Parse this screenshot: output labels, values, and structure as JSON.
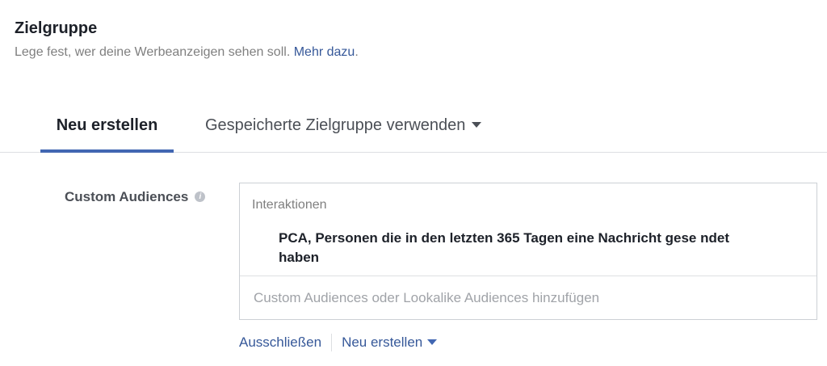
{
  "header": {
    "title": "Zielgruppe",
    "subtitle": "Lege fest, wer deine Werbeanzeigen sehen soll.",
    "subtitle_link": "Mehr dazu",
    "subtitle_end": "."
  },
  "tabs": [
    {
      "label": "Neu erstellen",
      "active": true
    },
    {
      "label": "Gespeicherte Zielgruppe verwenden",
      "icon": "caret-down-icon"
    }
  ],
  "custom_audiences": {
    "label": "Custom Audiences",
    "info_icon": "info-icon",
    "info_glyph": "i",
    "group_header": "Interaktionen",
    "selected_items": [
      "PCA, Personen die in den letzten 365 Tagen eine Nachricht gese ndet haben"
    ],
    "input_placeholder": "Custom Audiences oder Lookalike Audiences hinzufügen",
    "input_value": ""
  },
  "actions": {
    "exclude_label": "Ausschließen",
    "create_label": "Neu erstellen",
    "create_icon": "caret-down-icon"
  },
  "colors": {
    "accent": "#4267b2",
    "link": "#365899",
    "border": "#ccd0d5",
    "muted_text": "#7f7f7f"
  }
}
